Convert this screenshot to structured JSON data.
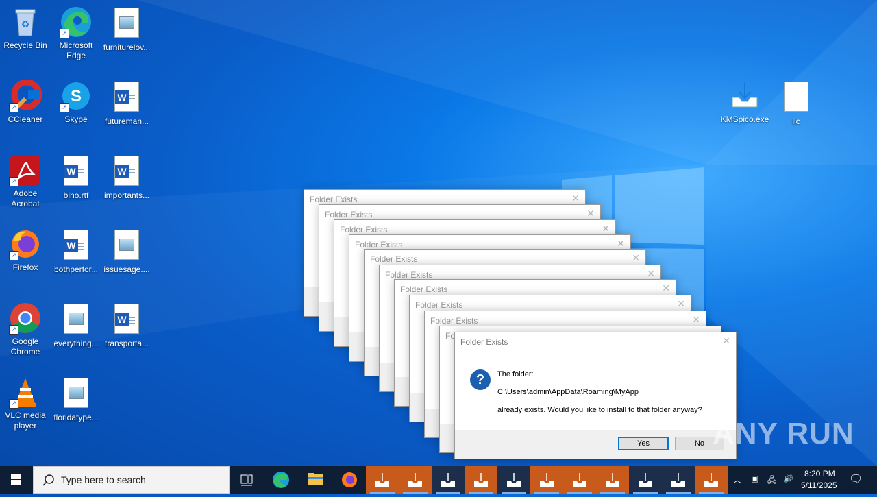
{
  "desktop_icons": [
    {
      "label": "Recycle Bin",
      "icon": "recycle-bin-icon"
    },
    {
      "label": "Microsoft Edge",
      "icon": "edge-icon"
    },
    {
      "label": "furniturelov...",
      "icon": "image-file-icon"
    },
    {
      "label": "CCleaner",
      "icon": "ccleaner-icon"
    },
    {
      "label": "Skype",
      "icon": "skype-icon"
    },
    {
      "label": "futureman...",
      "icon": "word-doc-icon"
    },
    {
      "label": "Adobe Acrobat",
      "icon": "acrobat-icon"
    },
    {
      "label": "bino.rtf",
      "icon": "word-doc-icon"
    },
    {
      "label": "importants...",
      "icon": "word-doc-icon"
    },
    {
      "label": "Firefox",
      "icon": "firefox-icon"
    },
    {
      "label": "bothperfor...",
      "icon": "word-doc-icon"
    },
    {
      "label": "issuesage....",
      "icon": "image-file-icon"
    },
    {
      "label": "Google Chrome",
      "icon": "chrome-icon"
    },
    {
      "label": "everything...",
      "icon": "image-file-icon"
    },
    {
      "label": "transporta...",
      "icon": "word-doc-icon"
    },
    {
      "label": "VLC media player",
      "icon": "vlc-icon"
    },
    {
      "label": "floridatype...",
      "icon": "image-file-icon"
    },
    {
      "label": "KMSpico.exe",
      "icon": "installer-icon"
    },
    {
      "label": "lic",
      "icon": "blank-file-icon"
    }
  ],
  "dialog": {
    "title": "Folder Exists",
    "line1": "The folder:",
    "path": "C:\\Users\\admin\\AppData\\Roaming\\MyApp",
    "line3": "already exists. Would you like to install to that folder anyway?",
    "yes": "Yes",
    "no": "No"
  },
  "background_dialog_title": "Folder Exists",
  "watermark": "ANY RUN",
  "taskbar": {
    "search_placeholder": "Type here to search",
    "time": "8:20 PM",
    "date": "5/11/2025"
  },
  "colors": {
    "accent": "#0078d7",
    "taskbar_app": "#c85a1c",
    "taskbar": "#0d1e35"
  }
}
